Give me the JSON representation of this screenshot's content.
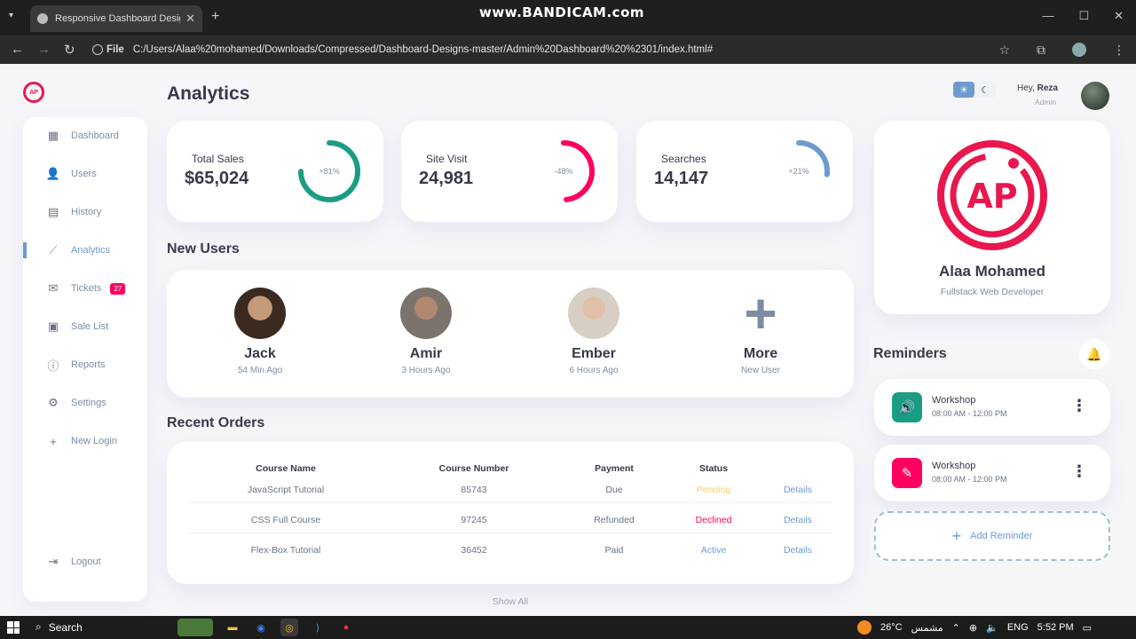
{
  "browser": {
    "tab_title": "Responsive Dashboard Design",
    "url_chip": "File",
    "url": "C:/Users/Alaa%20mohamed/Downloads/Compressed/Dashboard-Designs-master/Admin%20Dashboard%20%2301/index.html#",
    "watermark": "www.BANDICAM.com"
  },
  "sidebar": {
    "items": [
      {
        "label": "Dashboard",
        "icon": "grid-icon"
      },
      {
        "label": "Users",
        "icon": "person-icon"
      },
      {
        "label": "History",
        "icon": "receipt-icon"
      },
      {
        "label": "Analytics",
        "icon": "insights-icon",
        "active": true
      },
      {
        "label": "Tickets",
        "icon": "mail-icon",
        "badge": "27"
      },
      {
        "label": "Sale List",
        "icon": "inventory-icon"
      },
      {
        "label": "Reports",
        "icon": "report-icon"
      },
      {
        "label": "Settings",
        "icon": "settings-icon"
      },
      {
        "label": "New Login",
        "icon": "add-icon"
      }
    ],
    "logout": "Logout"
  },
  "header": {
    "title": "Analytics",
    "greeting": "Hey,",
    "user_name": "Reza",
    "user_role": "Admin"
  },
  "stats": [
    {
      "label": "Total Sales",
      "value": "$65,024",
      "percent_label": "+81%",
      "percent": 81,
      "color": "#1b9c85"
    },
    {
      "label": "Site Visit",
      "value": "24,981",
      "percent_label": "-48%",
      "percent": 48,
      "color": "#ff0060"
    },
    {
      "label": "Searches",
      "value": "14,147",
      "percent_label": "+21%",
      "percent": 21,
      "color": "#6c9bcf"
    }
  ],
  "new_users": {
    "title": "New Users",
    "users": [
      {
        "name": "Jack",
        "time": "54 Min Ago"
      },
      {
        "name": "Amir",
        "time": "3 Hours Ago"
      },
      {
        "name": "Ember",
        "time": "6 Hours Ago"
      },
      {
        "name": "More",
        "time": "New User"
      }
    ]
  },
  "orders": {
    "title": "Recent Orders",
    "headers": [
      "Course Name",
      "Course Number",
      "Payment",
      "Status"
    ],
    "rows": [
      {
        "course": "JavaScript Tutorial",
        "number": "85743",
        "payment": "Due",
        "status": "Pending",
        "status_color": "#f7d060",
        "action": "Details"
      },
      {
        "course": "CSS Full Course",
        "number": "97245",
        "payment": "Refunded",
        "status": "Declined",
        "status_color": "#ff0060",
        "action": "Details"
      },
      {
        "course": "Flex-Box Tutorial",
        "number": "36452",
        "payment": "Paid",
        "status": "Active",
        "status_color": "#6c9bcf",
        "action": "Details"
      }
    ],
    "show_all": "Show All"
  },
  "profile": {
    "name": "Alaa Mohamed",
    "role": "Fullstack Web Developer",
    "logo_text": "AP"
  },
  "reminders": {
    "title": "Reminders",
    "items": [
      {
        "title": "Workshop",
        "time": "08:00 AM - 12:00 PM",
        "color": "#1b9c85",
        "icon": "volume-icon"
      },
      {
        "title": "Workshop",
        "time": "08:00 AM - 12:00 PM",
        "color": "#ff0060",
        "icon": "edit-icon"
      }
    ],
    "add_label": "Add Reminder"
  },
  "taskbar": {
    "search": "Search",
    "weather": "26°C",
    "weather_text": "مشمس",
    "lang": "ENG",
    "time": "5:52 PM"
  }
}
